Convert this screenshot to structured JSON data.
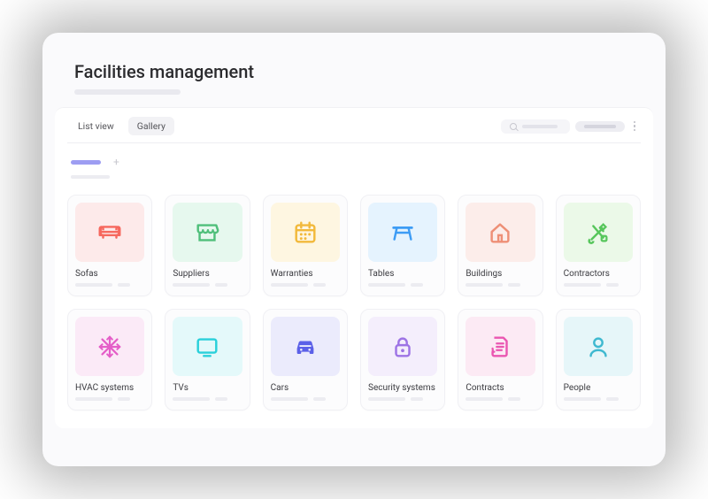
{
  "header": {
    "title": "Facilities management"
  },
  "toolbar": {
    "tabs": [
      {
        "label": "List view",
        "active": false
      },
      {
        "label": "Gallery",
        "active": true
      }
    ]
  },
  "cards": [
    {
      "label": "Sofas",
      "icon": "sofa-icon",
      "bg": "#FDEAEA",
      "fg": "#F6685E"
    },
    {
      "label": "Suppliers",
      "icon": "store-icon",
      "bg": "#E6F8EE",
      "fg": "#4FBF7A"
    },
    {
      "label": "Warranties",
      "icon": "calendar-icon",
      "bg": "#FEF6E1",
      "fg": "#F2B93B"
    },
    {
      "label": "Tables",
      "icon": "table-icon",
      "bg": "#E5F3FE",
      "fg": "#3D9CF5"
    },
    {
      "label": "Buildings",
      "icon": "home-icon",
      "bg": "#FCEDEA",
      "fg": "#EE8F76"
    },
    {
      "label": "Contractors",
      "icon": "tools-icon",
      "bg": "#EBF9E8",
      "fg": "#56C65B"
    },
    {
      "label": "HVAC systems",
      "icon": "snowflake-icon",
      "bg": "#FBEAF7",
      "fg": "#E45EC8"
    },
    {
      "label": "TVs",
      "icon": "tv-icon",
      "bg": "#E4F9FA",
      "fg": "#29D0DA"
    },
    {
      "label": "Cars",
      "icon": "car-icon",
      "bg": "#EBEBFC",
      "fg": "#5B60E8"
    },
    {
      "label": "Security systems",
      "icon": "lock-icon",
      "bg": "#F4EEFC",
      "fg": "#9D73E5"
    },
    {
      "label": "Contracts",
      "icon": "document-icon",
      "bg": "#FCEAF4",
      "fg": "#EA56B1"
    },
    {
      "label": "People",
      "icon": "person-icon",
      "bg": "#E6F6F9",
      "fg": "#3FB9D0"
    }
  ]
}
